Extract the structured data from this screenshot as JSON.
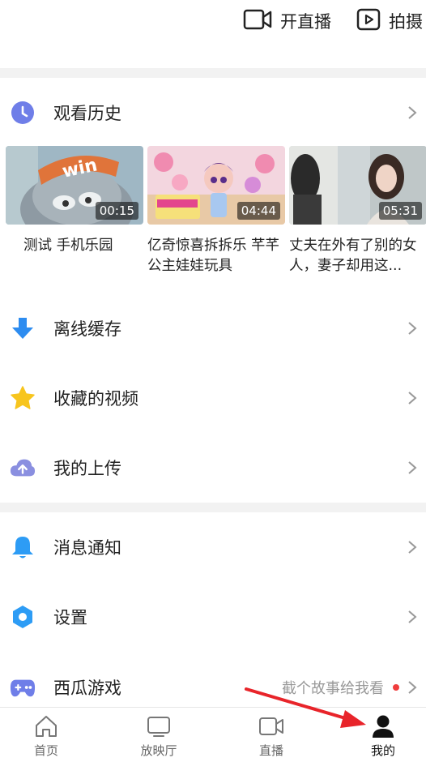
{
  "top_actions": {
    "live": "开直播",
    "shoot": "拍摄"
  },
  "history": {
    "label": "观看历史",
    "videos": [
      {
        "title": "测试 手机乐园",
        "duration": "00:15"
      },
      {
        "title": "亿奇惊喜拆拆乐 芊芊公主娃娃玩具",
        "duration": "04:44"
      },
      {
        "title": "丈夫在外有了别的女人，妻子却用这...",
        "duration": "05:31"
      }
    ]
  },
  "menu_a": {
    "offline": "离线缓存",
    "favorites": "收藏的视频",
    "uploads": "我的上传"
  },
  "menu_b": {
    "notifications": "消息通知",
    "settings": "设置",
    "games": "西瓜游戏",
    "games_extra": "截个故事给我看"
  },
  "tabs": [
    {
      "label": "首页",
      "icon": "home-icon"
    },
    {
      "label": "放映厅",
      "icon": "tv-icon"
    },
    {
      "label": "直播",
      "icon": "video-camera-icon"
    },
    {
      "label": "我的",
      "icon": "person-icon"
    }
  ],
  "colors": {
    "history_icon": "#6f7ee8",
    "offline_icon": "#2d8cf0",
    "favorites_icon": "#f7c51e",
    "upload_icon": "#8a8fe0",
    "notify_icon": "#2d9cf5",
    "settings_icon": "#2d9cf5",
    "games_icon": "#6f7ee8",
    "annotation_arrow": "#e8242a"
  }
}
